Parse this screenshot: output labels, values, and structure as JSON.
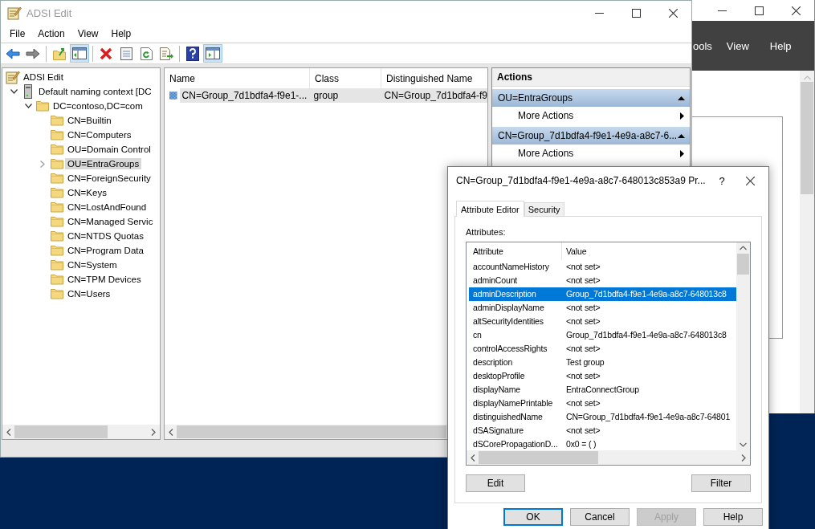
{
  "background_window": {
    "menu": [
      "ools",
      "View",
      "Help"
    ]
  },
  "main_window": {
    "title": "ADSI Edit",
    "menu": [
      "File",
      "Action",
      "View",
      "Help"
    ],
    "toolbar": [
      [
        {
          "kind": "back",
          "pressed": false
        },
        {
          "kind": "forward",
          "pressed": false
        }
      ],
      [
        {
          "kind": "up",
          "pressed": false
        },
        {
          "kind": "console-tree",
          "pressed": true
        }
      ],
      [
        {
          "kind": "delete",
          "pressed": false
        },
        {
          "kind": "properties",
          "pressed": false
        },
        {
          "kind": "refresh",
          "pressed": false
        },
        {
          "kind": "export",
          "pressed": false
        }
      ],
      [
        {
          "kind": "help",
          "pressed": false
        },
        {
          "kind": "action-pane",
          "pressed": true
        }
      ]
    ],
    "tree": {
      "label": "ADSI Edit",
      "children": [
        {
          "label": "Default naming context [DC",
          "kind": "server",
          "has_children": true,
          "expanded": true,
          "selected": false,
          "children": [
            {
              "label": "DC=contoso,DC=com",
              "kind": "folder",
              "has_children": true,
              "expanded": true,
              "selected": false,
              "children": [
                {
                  "label": "CN=Builtin",
                  "kind": "folder",
                  "has_children": false,
                  "expanded": false,
                  "selected": false
                },
                {
                  "label": "CN=Computers",
                  "kind": "folder",
                  "has_children": false,
                  "expanded": false,
                  "selected": false
                },
                {
                  "label": "OU=Domain Control",
                  "kind": "folder",
                  "has_children": false,
                  "expanded": false,
                  "selected": false
                },
                {
                  "label": "OU=EntraGroups",
                  "kind": "folder",
                  "has_children": true,
                  "expanded": false,
                  "selected": true
                },
                {
                  "label": "CN=ForeignSecurity",
                  "kind": "folder",
                  "has_children": false,
                  "expanded": false,
                  "selected": false
                },
                {
                  "label": "CN=Keys",
                  "kind": "folder",
                  "has_children": false,
                  "expanded": false,
                  "selected": false
                },
                {
                  "label": "CN=LostAndFound",
                  "kind": "folder",
                  "has_children": false,
                  "expanded": false,
                  "selected": false
                },
                {
                  "label": "CN=Managed Servic",
                  "kind": "folder",
                  "has_children": false,
                  "expanded": false,
                  "selected": false
                },
                {
                  "label": "CN=NTDS Quotas",
                  "kind": "folder",
                  "has_children": false,
                  "expanded": false,
                  "selected": false
                },
                {
                  "label": "CN=Program Data",
                  "kind": "folder",
                  "has_children": false,
                  "expanded": false,
                  "selected": false
                },
                {
                  "label": "CN=System",
                  "kind": "folder",
                  "has_children": false,
                  "expanded": false,
                  "selected": false
                },
                {
                  "label": "CN=TPM Devices",
                  "kind": "folder",
                  "has_children": false,
                  "expanded": false,
                  "selected": false
                },
                {
                  "label": "CN=Users",
                  "kind": "folder",
                  "has_children": false,
                  "expanded": false,
                  "selected": false
                }
              ]
            }
          ]
        }
      ]
    },
    "list": {
      "columns": [
        "Name",
        "Class",
        "Distinguished Name"
      ],
      "rows": [
        {
          "cells": [
            "CN=Group_7d1bdfa4-f9e1-...",
            "group",
            "CN=Group_7d1bdfa4-f9"
          ],
          "selected": true
        }
      ]
    },
    "actions": {
      "title": "Actions",
      "sections": [
        {
          "title": "OU=EntraGroups",
          "items": [
            "More Actions"
          ]
        },
        {
          "title": "CN=Group_7d1bdfa4-f9e1-4e9a-a8c7-6...",
          "items": [
            "More Actions"
          ]
        }
      ]
    }
  },
  "dialog": {
    "title": "CN=Group_7d1bdfa4-f9e1-4e9a-a8c7-648013c853a9 Pr...",
    "help_glyph": "?",
    "tabs": [
      {
        "label": "Attribute Editor",
        "selected": true
      },
      {
        "label": "Security",
        "selected": false
      }
    ],
    "attributes_label": "Attributes:",
    "columns": [
      "Attribute",
      "Value"
    ],
    "rows": [
      {
        "attribute": "accountNameHistory",
        "value": "<not set>",
        "selected": false
      },
      {
        "attribute": "adminCount",
        "value": "<not set>",
        "selected": false
      },
      {
        "attribute": "adminDescription",
        "value": "Group_7d1bdfa4-f9e1-4e9a-a8c7-648013c8",
        "selected": true
      },
      {
        "attribute": "adminDisplayName",
        "value": "<not set>",
        "selected": false
      },
      {
        "attribute": "altSecurityIdentities",
        "value": "<not set>",
        "selected": false
      },
      {
        "attribute": "cn",
        "value": "Group_7d1bdfa4-f9e1-4e9a-a8c7-648013c8",
        "selected": false
      },
      {
        "attribute": "controlAccessRights",
        "value": "<not set>",
        "selected": false
      },
      {
        "attribute": "description",
        "value": "Test group",
        "selected": false
      },
      {
        "attribute": "desktopProfile",
        "value": "<not set>",
        "selected": false
      },
      {
        "attribute": "displayName",
        "value": "EntraConnectGroup",
        "selected": false
      },
      {
        "attribute": "displayNamePrintable",
        "value": "<not set>",
        "selected": false
      },
      {
        "attribute": "distinguishedName",
        "value": "CN=Group_7d1bdfa4-f9e1-4e9a-a8c7-64801",
        "selected": false
      },
      {
        "attribute": "dSASignature",
        "value": "<not set>",
        "selected": false
      },
      {
        "attribute": "dSCorePropagationD...",
        "value": "0x0 = ( )",
        "selected": false
      }
    ],
    "list_buttons": [
      "Edit",
      "Filter"
    ],
    "buttons": [
      {
        "label": "OK",
        "default": true,
        "disabled": false
      },
      {
        "label": "Cancel",
        "default": false,
        "disabled": false
      },
      {
        "label": "Apply",
        "default": false,
        "disabled": true
      },
      {
        "label": "Help",
        "default": false,
        "disabled": false
      }
    ]
  }
}
